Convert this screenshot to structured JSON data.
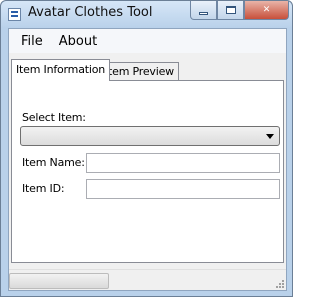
{
  "window": {
    "title": "Avatar Clothes Tool",
    "icons": {
      "app": "form-icon",
      "minimize": "minimize-icon",
      "maximize": "maximize-icon",
      "close": "close-icon"
    },
    "close_glyph": "✕"
  },
  "menu": {
    "file": "File",
    "about": "About"
  },
  "tabs": {
    "info": "Item Information",
    "preview": "Item Preview",
    "active": "Item Information"
  },
  "form": {
    "select_label": "Select Item:",
    "select_value": "",
    "name_label": "Item Name:",
    "name_value": "",
    "id_label": "Item ID:",
    "id_value": ""
  },
  "status": {
    "progress": 0
  },
  "colors": {
    "frame": "#b9d1ea",
    "client": "#f0f0f0",
    "close_button": "#c7503b"
  }
}
